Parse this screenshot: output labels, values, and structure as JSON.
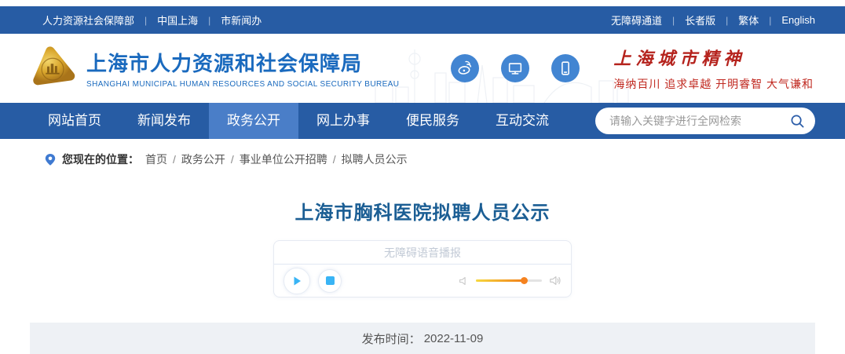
{
  "topbar": {
    "separator": "|",
    "left_links": [
      "人力资源社会保障部",
      "中国上海",
      "市新闻办"
    ],
    "right_links": [
      "无障碍通道",
      "长者版",
      "繁体",
      "English"
    ]
  },
  "header": {
    "title": "上海市人力资源和社会保障局",
    "subtitle": "SHANGHAI MUNICIPAL HUMAN RESOURCES AND SOCIAL SECURITY BUREAU",
    "motto_title": "上海城市精神",
    "motto_line": "海纳百川  追求卓越  开明睿智  大气谦和"
  },
  "nav": {
    "items": [
      {
        "label": "网站首页",
        "active": false
      },
      {
        "label": "新闻发布",
        "active": false
      },
      {
        "label": "政务公开",
        "active": true
      },
      {
        "label": "网上办事",
        "active": false
      },
      {
        "label": "便民服务",
        "active": false
      },
      {
        "label": "互动交流",
        "active": false
      }
    ],
    "search_placeholder": "请输入关键字进行全网检索"
  },
  "breadcrumb": {
    "label": "您现在的位置：",
    "separator": "/",
    "items": [
      "首页",
      "政务公开",
      "事业单位公开招聘",
      "拟聘人员公示"
    ]
  },
  "article": {
    "title": "上海市胸科医院拟聘人员公示",
    "audio_player_label": "无障碍语音播报",
    "publish_label": "发布时间：",
    "publish_date": "2022-11-09"
  },
  "icons": {
    "share": [
      "weibo-icon",
      "desktop-icon",
      "mobile-icon"
    ],
    "search": "search-icon",
    "breadcrumb": "location-pin-icon",
    "audio": [
      "play-icon",
      "stop-icon",
      "volume-down-icon",
      "volume-up-icon"
    ]
  },
  "colors": {
    "primary_blue": "#275CA4",
    "nav_active_blue": "#4A7EC8",
    "header_title_blue": "#1A6ABE",
    "article_title_blue": "#1B5E94",
    "motto_red": "#C0281F",
    "accent_orange": "#F5821F",
    "player_light_blue": "#39B4F5",
    "publish_bar_gray": "#EEF1F5"
  }
}
